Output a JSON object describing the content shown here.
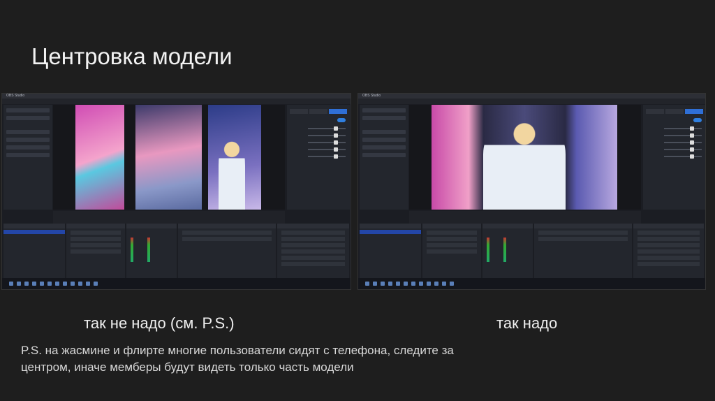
{
  "slide": {
    "title": "Центровка модели",
    "caption_wrong": "так не надо  (см. P.S.)",
    "caption_right": "так надо",
    "ps_note": "P.S. на жасмине и флирте многие пользователи сидят с телефона, следите за центром, иначе мемберы будут видеть только часть модели"
  },
  "screenshots": [
    {
      "name": "obs-off-center",
      "app": "OBS Studio"
    },
    {
      "name": "obs-centered",
      "app": "OBS Studio"
    }
  ]
}
